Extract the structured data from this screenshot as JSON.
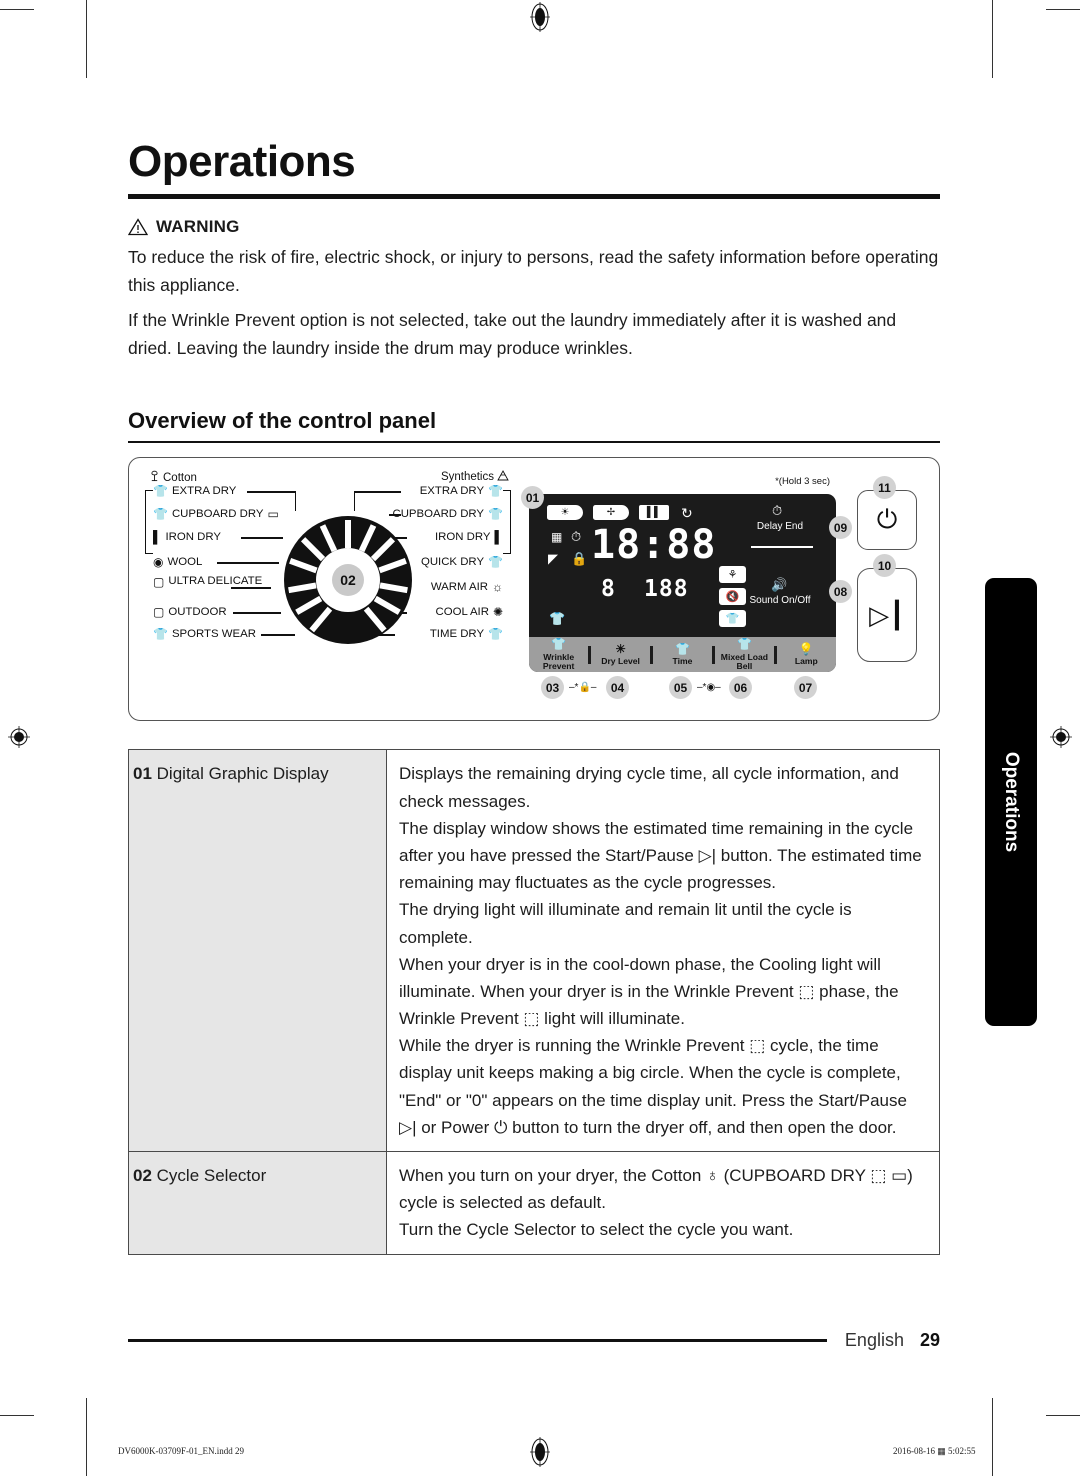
{
  "document": {
    "title": "Operations",
    "warning": {
      "label": "WARNING",
      "icon": "warning-triangle-icon",
      "paragraphs": [
        "To reduce the risk of fire, electric shock, or injury to persons, read the safety information before operating this appliance.",
        "If the Wrinkle Prevent option is not selected, take out the laundry immediately after it is washed and dried. Leaving the laundry inside the drum may produce wrinkles."
      ]
    },
    "section_heading": "Overview of the control panel"
  },
  "control_panel": {
    "dial": {
      "callout": "02",
      "left_group_title": "Cotton",
      "right_group_title": "Synthetics",
      "left_cycles": [
        "EXTRA DRY",
        "CUPBOARD DRY",
        "IRON DRY",
        "WOOL",
        "ULTRA DELICATE",
        "OUTDOOR",
        "SPORTS WEAR"
      ],
      "right_cycles": [
        "EXTRA DRY",
        "CUPBOARD DRY",
        "IRON DRY",
        "QUICK DRY",
        "WARM AIR",
        "COOL AIR",
        "TIME DRY"
      ]
    },
    "display": {
      "callout": "01",
      "hold_note": "*(Hold 3 sec)",
      "status_pills": [
        "sun-icon",
        "fan-icon",
        "pause-icon"
      ],
      "cooling_icon": "cooling-circle-icon",
      "main_time": "18:88",
      "sub_left": "8",
      "sub_right": "188",
      "indicator_icons": [
        "grid-icon",
        "clock-icon",
        "iron-icon",
        "child-lock-icon",
        "wrinkle-prevent-icon"
      ],
      "option_buttons": [
        "bell-icon",
        "mute-icon",
        "time-dry-icon"
      ],
      "delay_end": {
        "callout": "09",
        "label": "Delay End",
        "icon": "delay-clock-icon"
      },
      "sound_on_off": {
        "callout": "08",
        "label": "Sound On/Off",
        "icon": "speaker-icon"
      }
    },
    "touch_buttons": [
      {
        "callout": "03",
        "label": "Wrinkle Prevent",
        "icon": "wrinkle-prevent-icon"
      },
      {
        "callout": "04",
        "label": "Dry Level",
        "icon": "sun-icon"
      },
      {
        "callout": "05",
        "label": "Time",
        "icon": "time-dry-icon"
      },
      {
        "callout": "06",
        "label": "Mixed Load Bell",
        "icon": "mixed-load-bell-icon"
      },
      {
        "callout": "07",
        "label": "Lamp",
        "icon": "lamp-icon"
      }
    ],
    "hardware_buttons": [
      {
        "callout": "11",
        "name": "Power",
        "icon": "power-icon"
      },
      {
        "callout": "10",
        "name": "Start/Pause",
        "icon": "start-pause-icon"
      }
    ]
  },
  "table": {
    "rows": [
      {
        "number": "01",
        "name": "Digital Graphic Display",
        "paragraphs": [
          "Displays the remaining drying cycle time, all cycle information, and check messages.",
          "The display window shows the estimated time remaining in the cycle after you have pressed the Start/Pause ▷| button. The estimated time remaining may fluctuates as the cycle progresses.",
          "The drying light will illuminate and remain lit until the cycle is complete.",
          "When your dryer is in the cool-down phase, the Cooling light will illuminate. When your dryer is in the Wrinkle Prevent ⬚ phase, the Wrinkle Prevent ⬚ light will illuminate.",
          "While the dryer is running the Wrinkle Prevent ⬚ cycle, the time display unit keeps making a big circle. When the cycle is complete, \"End\" or \"0\" appears on the time display unit. Press the Start/Pause ▷| or Power ⏻ button to turn the dryer off, and then open the door."
        ]
      },
      {
        "number": "02",
        "name": "Cycle Selector",
        "paragraphs": [
          "When you turn on your dryer, the Cotton ♁ (CUPBOARD DRY ⬚ ▭) cycle is selected as default.",
          "Turn the Cycle Selector to select the cycle you want."
        ]
      }
    ]
  },
  "side_tab": {
    "label": "Operations"
  },
  "footer": {
    "language": "English",
    "page_number": "29",
    "print_file": "DV6000K-03709F-01_EN.indd   29",
    "print_date": "2016-08-16",
    "print_time": "5:02:55"
  }
}
